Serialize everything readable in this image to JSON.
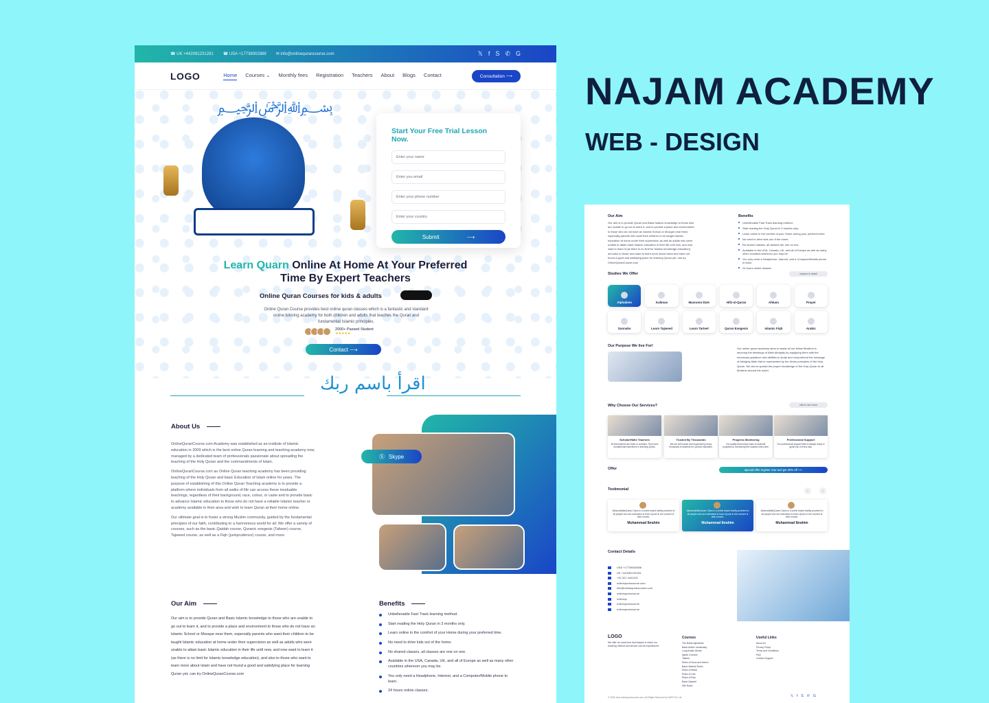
{
  "topbar": {
    "phone_uk": "☎ UK +442081231281",
    "phone_usa": "☎ USA +17738002888",
    "email": "✉ info@onlinequrancourse.com",
    "social_icons": [
      "x-icon",
      "facebook-icon",
      "skype-icon",
      "whatsapp-icon",
      "google-icon"
    ],
    "social_glyphs": [
      "𝕏",
      "f",
      "S",
      "✆",
      "G"
    ]
  },
  "nav": {
    "logo": "LOGO",
    "items": [
      "Home",
      "Courses ⌄",
      "Monthly fees",
      "Registration",
      "Teachers",
      "About",
      "Blogs",
      "Contact"
    ],
    "cta": "Consultation ⟶"
  },
  "hero": {
    "form_title": "Start Your Free Trial Lesson Now.",
    "placeholders": [
      "Enter your name",
      "Enter you email",
      "Enter your phone number",
      "Enter your country"
    ],
    "submit": "Submit",
    "submit_arrow": "⟶",
    "headline_highlight": "Learn Quarn",
    "headline_rest": "Online At Home At Your Preferred",
    "headline_line2": "Time By Expert Teachers",
    "subheading": "Online Quran Courses for kids & adults",
    "description": "Online Quran Course provides best online quran classes which is a fantastic and standard online tutoring academy for both children and adults that teaches the Quran and fundamental Islamic principles.",
    "students_label": "2000+ Passed Student",
    "stars": "★★★★★",
    "contact_button": "Contact ⟶"
  },
  "about": {
    "title": "About Us",
    "paragraphs": [
      "OnlineQuranCourse.com Academy was established as an institute of Islamic education in 2009 which is the best online Quran learning and teaching academy now, managed by a dedicated team of professionals passionate about spreading the teaching of the Holy Quran and the commandments of Islam.",
      "OnlineQuranCourse.com as Online Quran teaching academy has been providing teaching of the Holy Quran and basic Education of Islam online for years. The purpose of establishing of this Online Quran Teaching academy is to provide a platform where individuals from all walks of life can access these invaluable teachings, regardless of their background, race, colour, or caste and to provide basic to advance Islamic education to those who do not have a reliable Islamic teacher or academy available in their area and wish to learn Quran at their home online.",
      "Our ultimate goal is to foster a strong Muslim community, guided by the fundamental principles of our faith, contributing to a harmonious world for all. We offer a variety of courses, such as the basic Qaidah course, Quranic exegesis (Tafseer) course, Tajweed course, as well as a Fiqh (jurisprudence) course, and more."
    ],
    "skype_label": "Skype"
  },
  "aim": {
    "title": "Our Aim",
    "text": "Our aim is to provide Quran and Basic Islamic knowledge to those who are unable to go out to learn it, and to provide a place and environment to those who do not have an Islamic School or Mosque near them, especially parents who want their children to be taught Islamic education at home under their supervision as well as adults who were unable to attain basic Islamic education in their life until now, and now want to learn it (as there is no limit for Islamic knowledge education), and also to those who want to learn more about Islam and have not found a good and satisfying place for learning Quran yet, can try OnlineQuranCourse.com"
  },
  "benefits": {
    "title": "Benefits",
    "items": [
      "Unbelievable Fast Track learning method.",
      "Start reading the Holy Quran in 3 months only.",
      "Learn online in the comfort of your Home during your preferred time.",
      "No need to drive kids out of the home.",
      "No shared classes, all classes are one on one.",
      "Available in the USA, Canada, UK, and all of Europe as well as many other countries wherever you may be.",
      "You only need a Headphone, Internet, and a Computer/Mobile phone to learn.",
      "24 hours online classes."
    ]
  },
  "branding": {
    "title": "NAJAM ACADEMY",
    "subtitle": "WEB - DESIGN"
  },
  "mock2": {
    "aim_title": "Our Aim",
    "benefits_title": "Benefits",
    "studies_title": "Studies We Offer",
    "explore": "explore in detail",
    "studies": [
      {
        "name": "Alphabets",
        "sel": true
      },
      {
        "name": "Kalimas"
      },
      {
        "name": "Masnoon DUA"
      },
      {
        "name": "Hifz-ul-Quran"
      },
      {
        "name": "Ahkam"
      },
      {
        "name": "Prayer"
      },
      {
        "name": "Sunnahs"
      },
      {
        "name": "Learn Tajweed"
      },
      {
        "name": "Learn Tarteel"
      },
      {
        "name": "Quran Exegesis"
      },
      {
        "name": "Islamic Fiqh"
      },
      {
        "name": "Arabic"
      }
    ],
    "purpose_title": "Our Purpose We live For!",
    "purpose_text": "Our online quran academy aims to assist all our fellow Muslims in securing the blessings of Allah Almighty by equipping them with the necessary guidance and abilities to study and comprehend the message of Almighty Allah that is represented by the divine principles of the Holy Quran. We aim to spread the proper knowledge of the Holy Quran to all Muslims around the world.",
    "why_title": "Why Choose Our Services?",
    "see_more": "visit to see more",
    "services": [
      {
        "title": "Scholar/Hafiz Teachers",
        "text": "All the teachers are Hafiz or scholars. They have fundamental experience in teaching Quran."
      },
      {
        "title": "Trusted By Thousands",
        "text": "We are well known and respected by many thousands of students for Quranic education."
      },
      {
        "title": "Progress Monitoring",
        "text": "Our quality team keeps track of students' progress by monitoring their classes every time."
      },
      {
        "title": "Professional Support",
        "text": "Our professional support team is always ready to guide you in every way."
      }
    ],
    "offer_title": "Offer",
    "offer_bar": "special offer register now and get 30% off ⟶",
    "testimonial_title": "Testimonial",
    "testimonials": [
      {
        "text": "AlhamdulillahQuran Class is a online based facility provided to all people who are interested to learn Quran in the comfort of their homes.",
        "name": "Muhammad Ibrahim"
      },
      {
        "text": "AlhamdulillahQuran Class is a online based facility provided to all people who are interested to learn Quran in the comfort of their homes.",
        "name": "Muhammad Ibrahim",
        "sel": true
      },
      {
        "text": "AlhamdulillahQuran Class is a online based facility provided to all people who are interested to learn Quran in the comfort of their homes.",
        "name": "Muhammad Ibrahim"
      }
    ],
    "contact_title": "Contact Details",
    "contacts": [
      "USA +17738002888",
      "UK +442081231281",
      "+92 321 4441115",
      "onlinequrancourse.com",
      "info@onlinequrancourse.com",
      "onlinequrancourse",
      "onlineqc",
      "onlinequrancourse",
      "onlinequrancourse"
    ],
    "footer_logo": "LOGO",
    "footer_text": "We offer our week free trial classes in which our teaching method and service can be experienced.",
    "courses_title": "Courses",
    "courses": [
      "The Noble Alphabets",
      "Basic Arabic Vocabulary",
      "Long Arabic Words",
      "Ijazah Courses",
      "Tafseer",
      "Rules of Noon and Meem",
      "Basic Sabhah Rules",
      "Rules of Madd",
      "Rules of Lam",
      "Rules of Raa",
      "Basic Qawaid",
      "Hifz Rules"
    ],
    "links_title": "Useful Links",
    "links": [
      "About Us",
      "Privacy Policy",
      "Terms and Conditions",
      "FAQ",
      "Contact Support"
    ],
    "copyright": "© 2025 www.onlinequrancourse.com | All Rights Reserved by NAPS Pro Ltd",
    "social": [
      "𝕏",
      "f",
      "S",
      "✆",
      "G"
    ]
  }
}
